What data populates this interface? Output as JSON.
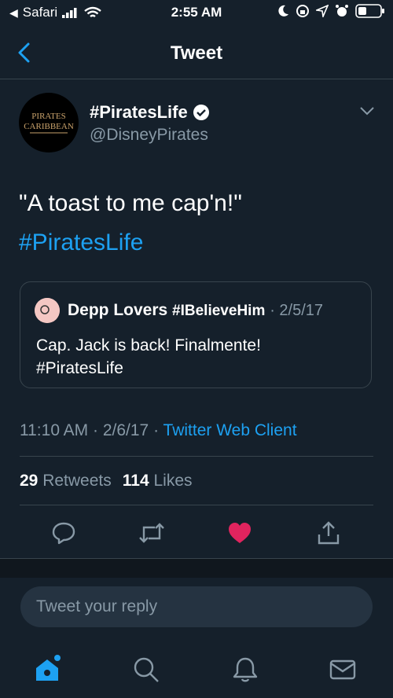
{
  "status_bar": {
    "back_app": "Safari",
    "time": "2:55 AM"
  },
  "nav": {
    "title": "Tweet"
  },
  "tweet": {
    "display_name": "#PiratesLife",
    "handle": "@DisneyPirates",
    "avatar_text_top": "PIRATES",
    "avatar_text_bottom": "CARIBBEAN",
    "text_line1": "\"A toast to me cap'n!\"",
    "hashtag": "#PiratesLife",
    "quote": {
      "name": "Depp Lovers",
      "tag": "#IBelieveHim",
      "date": "· 2/5/17",
      "text_line1": "Cap. Jack is back! Finalmente!",
      "text_line2": "#PiratesLife"
    },
    "time": "11:10 AM",
    "date": "2/6/17",
    "source": "Twitter Web Client",
    "retweets_count": "29",
    "retweets_label": "Retweets",
    "likes_count": "114",
    "likes_label": "Likes"
  },
  "reply": {
    "placeholder": "Tweet your reply"
  },
  "colors": {
    "accent": "#1da1f2",
    "like": "#e0245e",
    "background": "#15202b"
  }
}
